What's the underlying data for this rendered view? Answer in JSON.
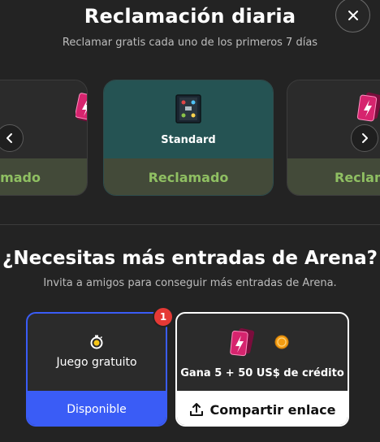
{
  "header": {
    "title": "Reclamación diaria",
    "subtitle": "Reclamar gratis cada uno de los primeros 7 días"
  },
  "carousel": {
    "left_card": {
      "status": "Reclamado"
    },
    "center_card": {
      "name": "Standard",
      "status": "Reclamado"
    },
    "right_card": {
      "status": "Reclamado"
    }
  },
  "arena": {
    "title": "¿Necesitas más entradas de Arena?",
    "subtitle": "Invita a amigos para conseguir más entradas de Arena."
  },
  "free_game": {
    "label": "Juego gratuito",
    "status": "Disponible",
    "badge_count": "1"
  },
  "share": {
    "earn_text": "Gana 5  + 50 US$ de crédito",
    "button_label": "Compartir enlace"
  },
  "colors": {
    "accent_blue": "#3a5cf6",
    "claimed_green": "#8fbf62",
    "badge_red": "#e53935",
    "center_card_teal": "#255353"
  }
}
